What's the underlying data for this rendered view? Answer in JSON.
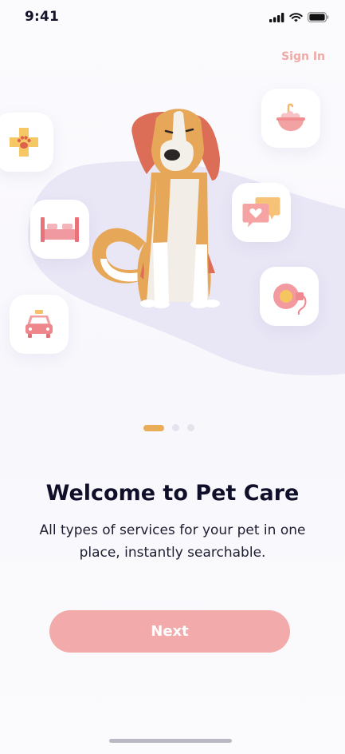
{
  "status_bar": {
    "time": "9:41"
  },
  "header": {
    "sign_in_label": "Sign In"
  },
  "illustration": {
    "feature_icons": [
      "vet-care-icon",
      "pet-hotel-icon",
      "pet-taxi-icon",
      "grooming-icon",
      "pet-chat-icon",
      "dog-walking-icon"
    ],
    "colors": {
      "blob": "#e9e7f6",
      "dog_orange": "#e6a858",
      "dog_red": "#dc6e57"
    }
  },
  "onboarding": {
    "current_page": 1,
    "total_pages": 3,
    "title": "Welcome to Pet Care",
    "subtitle": "All types of services for your pet in one place, instantly searchable.",
    "next_label": "Next"
  },
  "colors": {
    "accent": "#f2abaa",
    "active_dot": "#e9ac57",
    "inactive_dot": "#e4e4ef"
  }
}
